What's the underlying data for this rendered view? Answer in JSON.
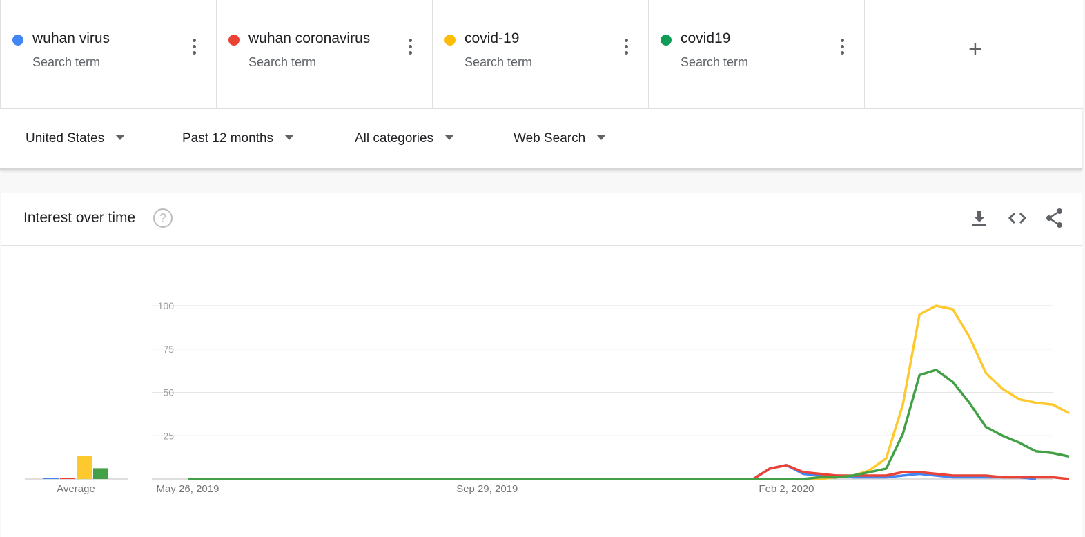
{
  "terms": [
    {
      "name": "wuhan virus",
      "sub": "Search term",
      "color": "#4285f4"
    },
    {
      "name": "wuhan coronavirus",
      "sub": "Search term",
      "color": "#ea4335"
    },
    {
      "name": "covid-19",
      "sub": "Search term",
      "color": "#fbbc04"
    },
    {
      "name": "covid19",
      "sub": "Search term",
      "color": "#0f9d58"
    }
  ],
  "add_label": "+",
  "filters": {
    "region": "United States",
    "time": "Past 12 months",
    "category": "All categories",
    "search_type": "Web Search"
  },
  "card": {
    "title": "Interest over time",
    "help": "?"
  },
  "chart_data": {
    "type": "line",
    "yticks": [
      100,
      75,
      50,
      25
    ],
    "ylim": [
      0,
      100
    ],
    "x_labels": [
      "May 26, 2019",
      "Sep 29, 2019",
      "Feb 2, 2020"
    ],
    "x_label_weeks": [
      0,
      18,
      36
    ],
    "n_weeks": 52,
    "series": [
      {
        "name": "wuhan virus",
        "color": "#4285f4",
        "values": [
          0,
          0,
          0,
          0,
          0,
          0,
          0,
          0,
          0,
          0,
          0,
          0,
          0,
          0,
          0,
          0,
          0,
          0,
          0,
          0,
          0,
          0,
          0,
          0,
          0,
          0,
          0,
          0,
          0,
          0,
          0,
          0,
          0,
          0,
          0,
          6,
          8,
          3,
          2,
          2,
          1,
          1,
          1,
          2,
          3,
          2,
          1,
          1,
          1,
          1,
          1,
          0
        ]
      },
      {
        "name": "wuhan coronavirus",
        "color": "#ea4335",
        "values": [
          0,
          0,
          0,
          0,
          0,
          0,
          0,
          0,
          0,
          0,
          0,
          0,
          0,
          0,
          0,
          0,
          0,
          0,
          0,
          0,
          0,
          0,
          0,
          0,
          0,
          0,
          0,
          0,
          0,
          0,
          0,
          0,
          0,
          0,
          0,
          6,
          8,
          4,
          3,
          2,
          2,
          2,
          2,
          4,
          4,
          3,
          2,
          2,
          2,
          1,
          1,
          1,
          1,
          0
        ]
      },
      {
        "name": "covid-19",
        "color": "#fdc92f",
        "values": [
          0,
          0,
          0,
          0,
          0,
          0,
          0,
          0,
          0,
          0,
          0,
          0,
          0,
          0,
          0,
          0,
          0,
          0,
          0,
          0,
          0,
          0,
          0,
          0,
          0,
          0,
          0,
          0,
          0,
          0,
          0,
          0,
          0,
          0,
          0,
          0,
          0,
          0,
          0,
          1,
          2,
          5,
          12,
          43,
          95,
          100,
          98,
          82,
          61,
          52,
          46,
          44,
          43,
          38
        ]
      },
      {
        "name": "covid19",
        "color": "#43a047",
        "values": [
          0,
          0,
          0,
          0,
          0,
          0,
          0,
          0,
          0,
          0,
          0,
          0,
          0,
          0,
          0,
          0,
          0,
          0,
          0,
          0,
          0,
          0,
          0,
          0,
          0,
          0,
          0,
          0,
          0,
          0,
          0,
          0,
          0,
          0,
          0,
          0,
          0,
          0,
          1,
          1,
          2,
          4,
          6,
          26,
          60,
          63,
          56,
          44,
          30,
          25,
          21,
          16,
          15,
          13
        ]
      }
    ],
    "average": {
      "label": "Average",
      "values": [
        0.5,
        0.7,
        14,
        6.5
      ]
    }
  }
}
